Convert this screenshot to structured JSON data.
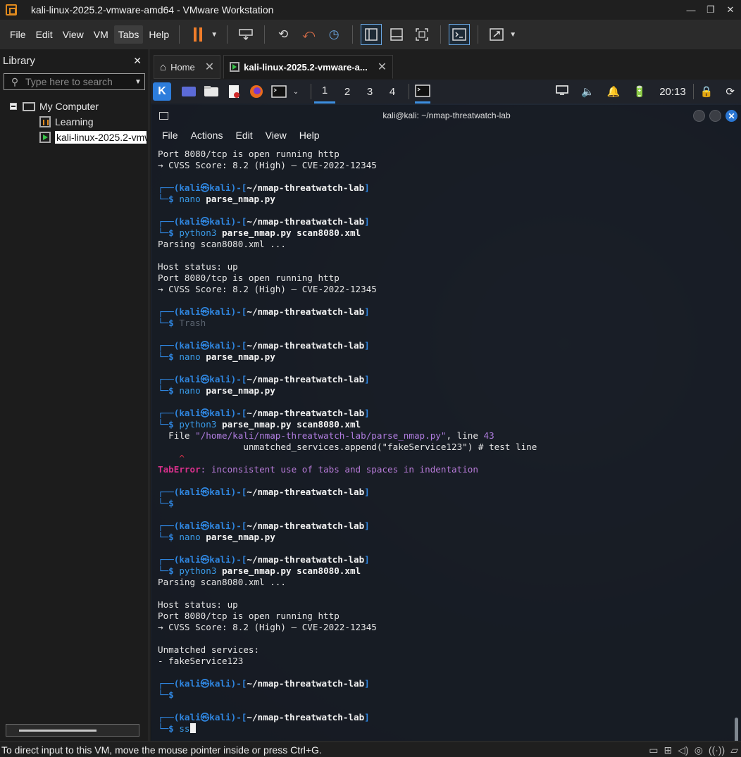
{
  "window": {
    "title": "kali-linux-2025.2-vmware-amd64 - VMware Workstation",
    "controls": [
      "—",
      "❐",
      "✕"
    ]
  },
  "menu": [
    "File",
    "Edit",
    "View",
    "VM",
    "Tabs",
    "Help"
  ],
  "library": {
    "title": "Library",
    "close": "✕",
    "search_placeholder": "Type here to search",
    "tree": {
      "root": "My Computer",
      "items": [
        "Learning",
        "kali-linux-2025.2-vmware-amd64"
      ]
    }
  },
  "tabs": [
    {
      "label": "Home"
    },
    {
      "label": "kali-linux-2025.2-vmware-a..."
    }
  ],
  "kali_panel": {
    "workspaces": [
      "1",
      "2",
      "3",
      "4"
    ],
    "clock": "20:13"
  },
  "terminal": {
    "title": "kali@kali: ~/nmap-threatwatch-lab",
    "menu": [
      "File",
      "Actions",
      "Edit",
      "View",
      "Help"
    ],
    "prompt": {
      "user": "kali",
      "at": "㉿",
      "host": "kali",
      "path": "~/nmap-threatwatch-lab"
    },
    "lines": [
      {
        "t": "out",
        "text": "Port 8080/tcp is open running http"
      },
      {
        "t": "out",
        "text": "→ CVSS Score: 8.2 (High) — CVE-2022-12345"
      },
      {
        "t": "blank"
      },
      {
        "t": "prompt"
      },
      {
        "t": "cmd",
        "cmd": "nano",
        "args": "parse_nmap.py"
      },
      {
        "t": "blank"
      },
      {
        "t": "prompt"
      },
      {
        "t": "cmd",
        "cmd": "python3",
        "args": "parse_nmap.py scan8080.xml"
      },
      {
        "t": "out",
        "text": "Parsing scan8080.xml ..."
      },
      {
        "t": "blank"
      },
      {
        "t": "out",
        "text": "Host status: up"
      },
      {
        "t": "out",
        "text": "Port 8080/tcp is open running http"
      },
      {
        "t": "out",
        "text": "→ CVSS Score: 8.2 (High) — CVE-2022-12345"
      },
      {
        "t": "blank"
      },
      {
        "t": "prompt"
      },
      {
        "t": "cmd",
        "cmd": "",
        "args": "",
        "ghost": "Trash"
      },
      {
        "t": "blank"
      },
      {
        "t": "prompt"
      },
      {
        "t": "cmd",
        "cmd": "nano",
        "args": "parse_nmap.py"
      },
      {
        "t": "blank"
      },
      {
        "t": "prompt"
      },
      {
        "t": "cmd",
        "cmd": "nano",
        "args": "parse_nmap.py"
      },
      {
        "t": "blank"
      },
      {
        "t": "prompt"
      },
      {
        "t": "cmd",
        "cmd": "python3",
        "args": "parse_nmap.py scan8080.xml"
      },
      {
        "t": "file",
        "pre": "  File ",
        "path": "\"/home/kali/nmap-threatwatch-lab/parse_nmap.py\"",
        "mid": ", line ",
        "num": "43"
      },
      {
        "t": "out",
        "text": "                unmatched_services.append(\"fakeService123\") # test line"
      },
      {
        "t": "caret",
        "text": "    ^"
      },
      {
        "t": "error",
        "name": "TabError",
        "msg": ": inconsistent use of tabs and spaces in indentation"
      },
      {
        "t": "blank"
      },
      {
        "t": "prompt"
      },
      {
        "t": "cmd",
        "cmd": "",
        "args": ""
      },
      {
        "t": "blank"
      },
      {
        "t": "prompt"
      },
      {
        "t": "cmd",
        "cmd": "nano",
        "args": "parse_nmap.py"
      },
      {
        "t": "blank"
      },
      {
        "t": "prompt"
      },
      {
        "t": "cmd",
        "cmd": "python3",
        "args": "parse_nmap.py scan8080.xml"
      },
      {
        "t": "out",
        "text": "Parsing scan8080.xml ..."
      },
      {
        "t": "blank"
      },
      {
        "t": "out",
        "text": "Host status: up"
      },
      {
        "t": "out",
        "text": "Port 8080/tcp is open running http"
      },
      {
        "t": "out",
        "text": "→ CVSS Score: 8.2 (High) — CVE-2022-12345"
      },
      {
        "t": "blank"
      },
      {
        "t": "out",
        "text": "Unmatched services:"
      },
      {
        "t": "out",
        "text": "- fakeService123"
      },
      {
        "t": "blank"
      },
      {
        "t": "prompt"
      },
      {
        "t": "cmd",
        "cmd": "",
        "args": ""
      },
      {
        "t": "blank"
      },
      {
        "t": "prompt"
      },
      {
        "t": "cmd",
        "cmd": "ss",
        "args": "",
        "cursor": true
      }
    ]
  },
  "statusbar": {
    "message": "To direct input to this VM, move the mouse pointer inside or press Ctrl+G."
  },
  "icons": {
    "search": "⚲",
    "dropdown": "▼",
    "home": "⌂",
    "snapshot": "⟲",
    "revert": "⤺",
    "manage": "◷",
    "volume": "🔈",
    "bell": "🔔",
    "battery": "🔋",
    "lock": "🔒",
    "refresh": "⟳"
  },
  "colors": {
    "accent_blue": "#2f86e0",
    "pause_orange": "#f07d2a",
    "vm_running_green": "#39c34a",
    "error_pink": "#d6308a"
  }
}
